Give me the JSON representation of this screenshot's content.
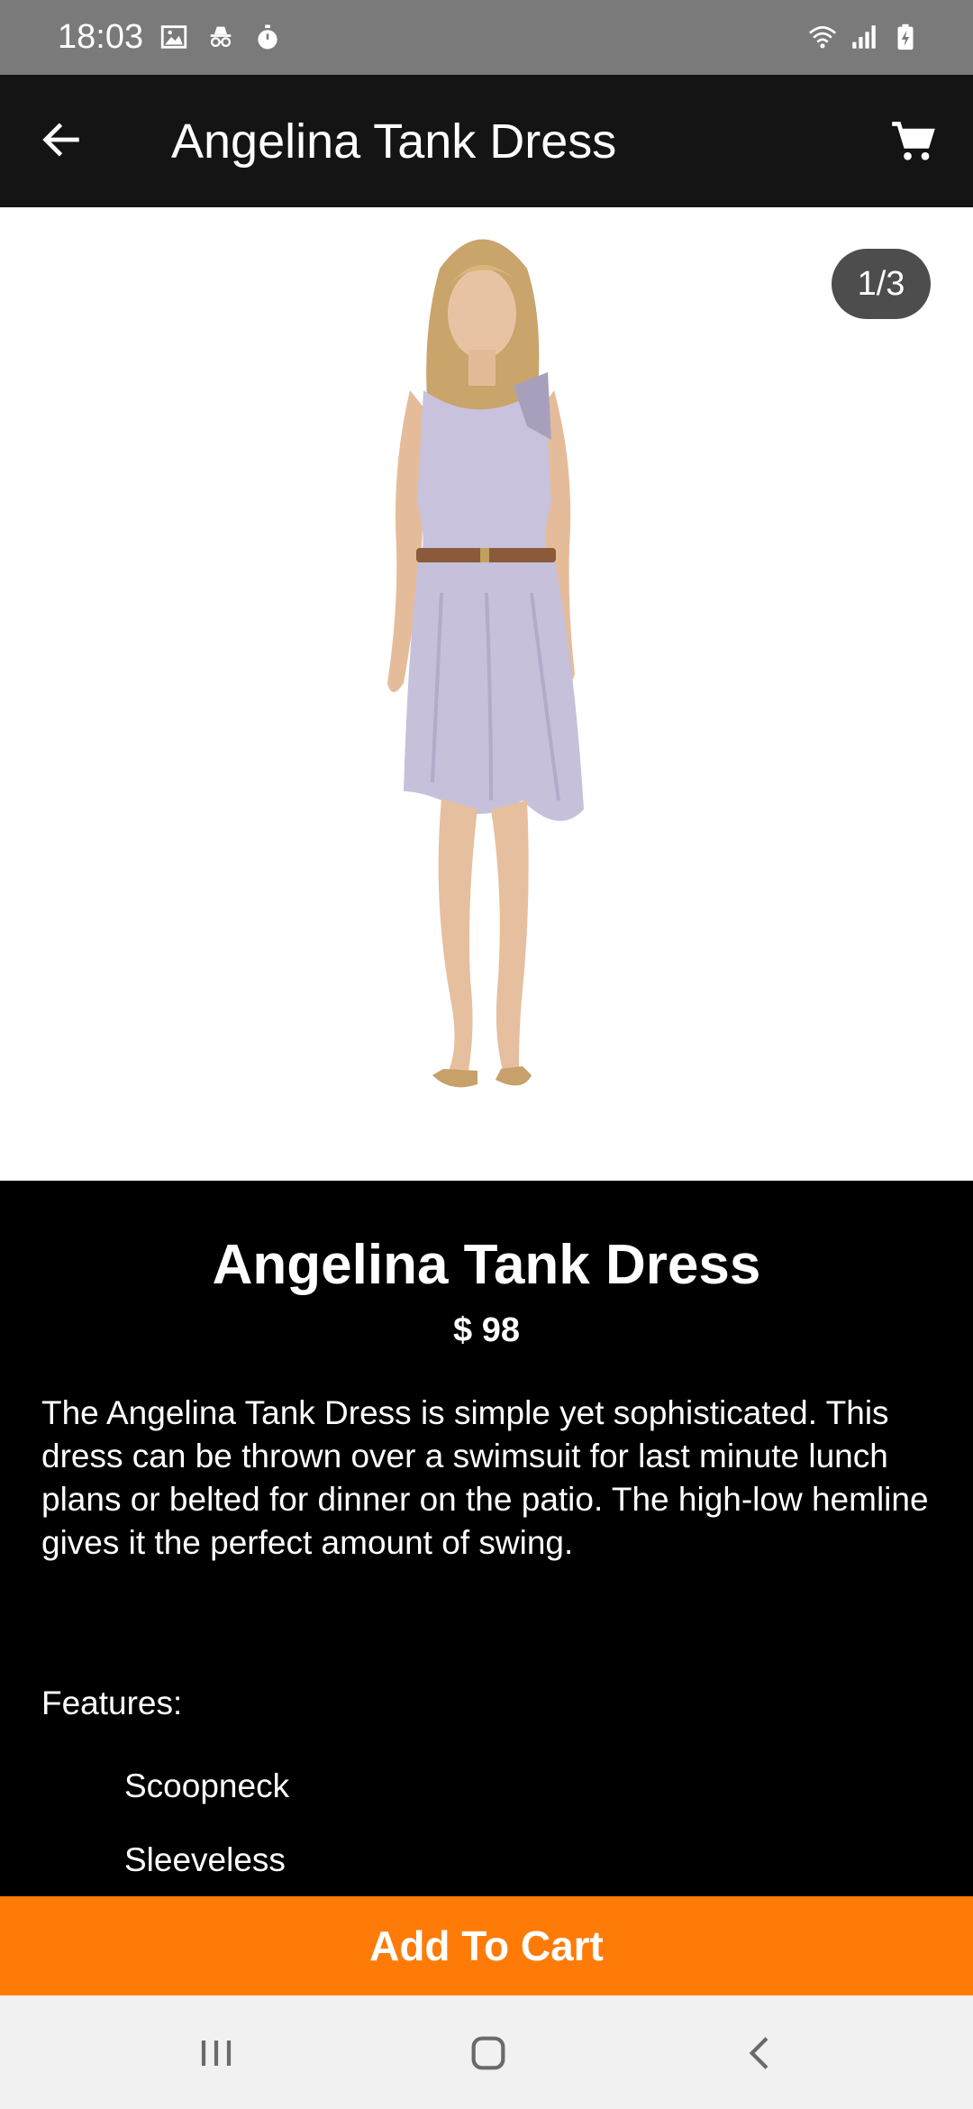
{
  "status_bar": {
    "time": "18:03",
    "left_icons": [
      "gallery-icon",
      "incognito-icon",
      "stopwatch-icon"
    ],
    "right_icons": [
      "wifi-icon",
      "signal-icon",
      "battery-charging-icon"
    ]
  },
  "app_bar": {
    "title": "Angelina Tank Dress",
    "back_icon": "arrow-back-icon",
    "cart_icon": "shopping-cart-icon"
  },
  "gallery": {
    "page_indicator": "1/3",
    "current_page": 1,
    "total_pages": 3
  },
  "product": {
    "name": "Angelina Tank Dress",
    "price": "$ 98",
    "description": "The Angelina Tank Dress is simple yet sophisticated. This dress can be thrown over a swimsuit for last minute lunch plans or belted for dinner on the patio. The high-low hemline gives it the perfect amount of swing.",
    "features_label": "Features:",
    "features": [
      "Scoopneck",
      "Sleeveless"
    ]
  },
  "actions": {
    "add_to_cart": "Add To Cart"
  },
  "nav_bar": {
    "icons": [
      "recent-apps-icon",
      "home-icon",
      "back-icon"
    ]
  },
  "colors": {
    "status_bar": "#7a7a7a",
    "app_bar": "#141414",
    "accent": "#ff7b08",
    "details_bg": "#000000",
    "page_indicator_bg": "#4d4d4d"
  }
}
